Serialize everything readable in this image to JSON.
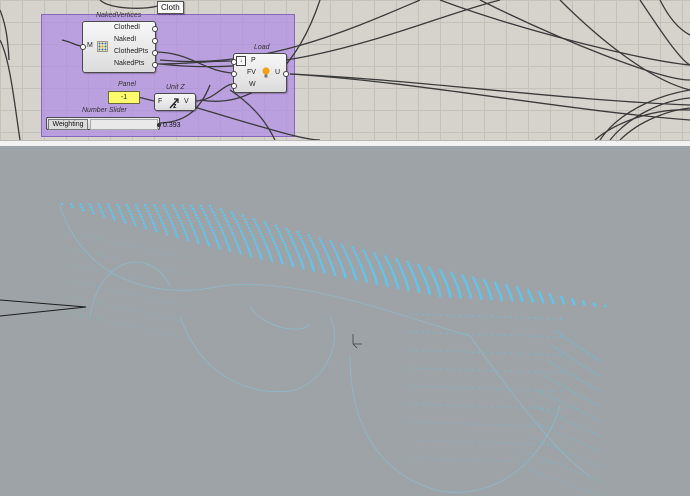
{
  "canvas": {
    "cloth_tag": "Cloth",
    "components": {
      "naked_vertices": {
        "title": "NakedVertices",
        "input": "M",
        "outputs": [
          "ClothedI",
          "NakedI",
          "ClothedPts",
          "NakedPts"
        ],
        "icon": "mesh-vertices-icon"
      },
      "load": {
        "title": "Load",
        "inputs": [
          "P",
          "FV",
          "W"
        ],
        "output": "U",
        "icon": "lightbulb-icon"
      },
      "panel": {
        "title": "Panel",
        "value": "-1"
      },
      "unit_z": {
        "title": "Unit Z",
        "input": "F",
        "output": "V",
        "icon": "unit-z-arrow-icon"
      },
      "number_slider": {
        "title": "Number Slider",
        "label": "Weighting",
        "value": "0.393",
        "fraction": 0.393
      }
    }
  },
  "colors": {
    "group": "#b08ce8",
    "points": "#5cc8f0",
    "panel": "#fdfb6b",
    "canvas": "#d6d3cd",
    "viewport": "#9ea3a8"
  }
}
